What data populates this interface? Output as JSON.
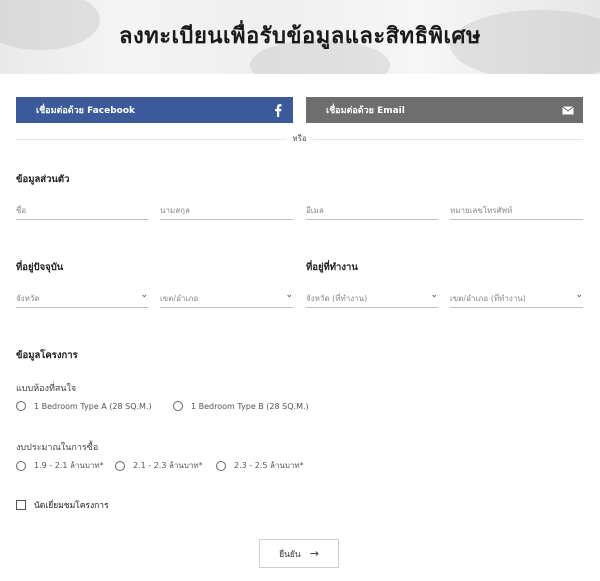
{
  "header": {
    "title": "ลงทะเบียนเพื่อรับข้อมูลและสิทธิพิเศษ"
  },
  "social": {
    "facebook_label": "เชื่อมต่อด้วย Facebook",
    "facebook_icon": "facebook-icon",
    "email_label": "เชื่อมต่อด้วย Email",
    "email_icon": "envelope-icon",
    "facebook_color": "#3c5a99",
    "email_color": "#6e6e6e"
  },
  "divider": {
    "or_text": "หรือ"
  },
  "personal": {
    "title": "ข้อมูลส่วนตัว",
    "first_name": "ชื่อ",
    "last_name": "นามสกุล",
    "email": "อีเมล",
    "phone": "หมายเลขโทรศัพท์"
  },
  "home_address": {
    "title": "ที่อยู่ปัจจุบัน",
    "province": "จังหวัด",
    "district": "เขต/อำเภอ"
  },
  "work_address": {
    "title": "ที่อยู่ที่ทำงาน",
    "province": "จังหวัด (ที่ทำงาน)",
    "district": "เขต/อำเภอ (ที่ทำงาน)"
  },
  "project": {
    "title": "ข้อมูลโครงการ",
    "room_type_label": "แบบห้องที่สนใจ",
    "room_types": [
      "1 Bedroom Type A (28 SQ.M.)",
      "1 Bedroom Type B (28 SQ.M.)"
    ],
    "budget_label": "งบประมาณในการซื้อ",
    "budgets": [
      "1.9 - 2.1 ล้านบาท*",
      "2.1 - 2.3 ล้านบาท*",
      "2.3 - 2.5 ล้านบาท*"
    ],
    "appointment_label": "นัดเยี่ยมชมโครงการ"
  },
  "submit": {
    "label": "ยืนยัน"
  }
}
